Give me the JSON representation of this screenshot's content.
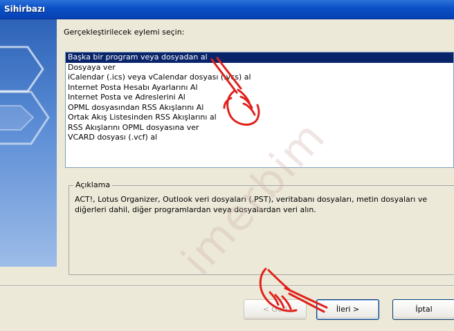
{
  "window": {
    "title": "Sihirbazı"
  },
  "prompt": "Gerçekleştirilecek eylemi seçin:",
  "actions": [
    "Başka bir program veya dosyadan al",
    "Dosyaya ver",
    "iCalendar (.ics) veya vCalendar dosyası (.vcs) al",
    "Internet Posta Hesabı Ayarlarını Al",
    "Internet Posta ve Adreslerini Al",
    "OPML dosyasından RSS Akışlarını Al",
    "Ortak Akış Listesinden RSS Akışlarını al",
    "RSS Akışlarını OPML dosyasına ver",
    "VCARD dosyası (.vcf) al"
  ],
  "selected_index": 0,
  "description": {
    "legend": "Açıklama",
    "text": "ACT!, Lotus Organizer, Outlook veri dosyaları (.PST), veritabanı dosyaları, metin dosyaları ve diğerleri dahil, diğer programlardan veya dosyalardan veri alın."
  },
  "buttons": {
    "back": "< Geri",
    "next": "İleri >",
    "cancel": "İptal"
  },
  "watermark": "imerbim",
  "colors": {
    "titlebar": "#0a4fc6",
    "selection": "#0a246a",
    "hand": "#e0201b"
  }
}
